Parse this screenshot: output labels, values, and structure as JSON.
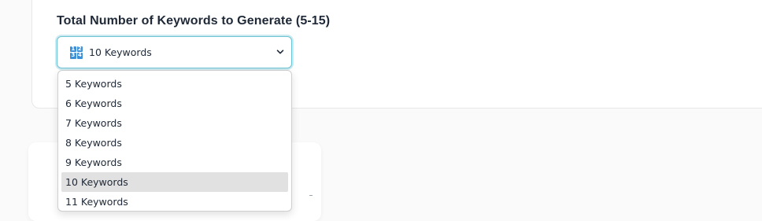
{
  "field": {
    "label": "Total Number of Keywords to Generate (5-15)",
    "icon": "input-numbers-icon",
    "icon_digits": [
      "1",
      "2",
      "3",
      "4"
    ],
    "selected_value": "10 Keywords"
  },
  "dropdown": {
    "options": [
      {
        "label": "5 Keywords",
        "selected": false
      },
      {
        "label": "6 Keywords",
        "selected": false
      },
      {
        "label": "7 Keywords",
        "selected": false
      },
      {
        "label": "8 Keywords",
        "selected": false
      },
      {
        "label": "9 Keywords",
        "selected": false
      },
      {
        "label": "10 Keywords",
        "selected": true
      },
      {
        "label": "11 Keywords",
        "selected": false
      }
    ]
  },
  "colors": {
    "focus_border": "#6cc3d3",
    "icon_blue": "#3d8fd6",
    "selected_option_bg": "#e1e1e1"
  }
}
